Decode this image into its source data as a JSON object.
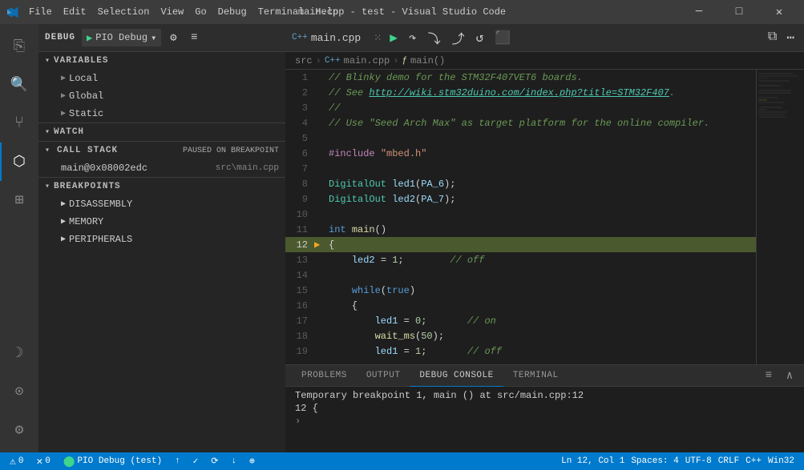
{
  "titleBar": {
    "title": "main.cpp - test - Visual Studio Code",
    "menus": [
      "File",
      "Edit",
      "Selection",
      "View",
      "Go",
      "Debug",
      "Terminal",
      "Help"
    ],
    "controls": [
      "─",
      "□",
      "✕"
    ]
  },
  "activityBar": {
    "items": [
      {
        "name": "explorer",
        "icon": "⎘",
        "label": "Explorer"
      },
      {
        "name": "search",
        "icon": "🔍",
        "label": "Search"
      },
      {
        "name": "source-control",
        "icon": "⑂",
        "label": "Source Control"
      },
      {
        "name": "debug",
        "icon": "▶",
        "label": "Run and Debug",
        "active": true
      },
      {
        "name": "extensions",
        "icon": "⊞",
        "label": "Extensions"
      }
    ],
    "bottomItems": [
      {
        "name": "settings-bot",
        "icon": "☽",
        "label": "PlatformIO"
      },
      {
        "name": "accounts",
        "icon": "⊙",
        "label": "Accounts"
      },
      {
        "name": "settings",
        "icon": "⚙",
        "label": "Settings"
      }
    ]
  },
  "debugPanel": {
    "label": "DEBUG",
    "dropdown": "PIO Debug",
    "toolbar": [
      "▶",
      "⚙",
      "≡"
    ]
  },
  "variables": {
    "header": "VARIABLES",
    "items": [
      {
        "label": "Local",
        "indent": 1,
        "expanded": false
      },
      {
        "label": "Global",
        "indent": 1,
        "expanded": false
      },
      {
        "label": "Static",
        "indent": 1,
        "expanded": false
      }
    ]
  },
  "watch": {
    "header": "WATCH"
  },
  "callStack": {
    "header": "CALL STACK",
    "badge": "PAUSED ON BREAKPOINT",
    "items": [
      {
        "name": "main@0x08002edc",
        "file": "src\\main.cpp"
      }
    ]
  },
  "breakpoints": {
    "header": "BREAKPOINTS",
    "subitems": [
      {
        "label": "DISASSEMBLY"
      },
      {
        "label": "MEMORY"
      },
      {
        "label": "PERIPHERALS"
      }
    ]
  },
  "editorToolbar": {
    "file": "main.cpp",
    "fileIcon": "C++",
    "icons": [
      {
        "name": "split-view",
        "symbol": "⊡"
      },
      {
        "name": "continue",
        "symbol": "▶"
      },
      {
        "name": "step-over",
        "symbol": "↷"
      },
      {
        "name": "step-into",
        "symbol": "⤵"
      },
      {
        "name": "step-out",
        "symbol": "⤴"
      },
      {
        "name": "restart",
        "symbol": "↺"
      },
      {
        "name": "stop",
        "symbol": "⬛",
        "stop": true
      }
    ]
  },
  "breadcrumb": {
    "parts": [
      "src",
      "main.cpp",
      "main()"
    ]
  },
  "code": {
    "lines": [
      {
        "num": 1,
        "content": "// Blinky demo for the STM32F407VET6 boards."
      },
      {
        "num": 2,
        "content": "// See http://wiki.stm32duino.com/index.php?title=STM32F407."
      },
      {
        "num": 3,
        "content": "//"
      },
      {
        "num": 4,
        "content": "// Use \"Seed Arch Max\" as target platform for the online compiler."
      },
      {
        "num": 5,
        "content": ""
      },
      {
        "num": 6,
        "content": "#include \"mbed.h\""
      },
      {
        "num": 7,
        "content": ""
      },
      {
        "num": 8,
        "content": "DigitalOut led1(PA_6);"
      },
      {
        "num": 9,
        "content": "DigitalOut led2(PA_7);"
      },
      {
        "num": 10,
        "content": ""
      },
      {
        "num": 11,
        "content": "int main()"
      },
      {
        "num": 12,
        "content": "{",
        "current": true,
        "arrow": true
      },
      {
        "num": 13,
        "content": "    led2 = 1;        // off"
      },
      {
        "num": 14,
        "content": ""
      },
      {
        "num": 15,
        "content": "    while(true)"
      },
      {
        "num": 16,
        "content": "    {"
      },
      {
        "num": 17,
        "content": "        led1 = 0;       // on"
      },
      {
        "num": 18,
        "content": "        wait_ms(50);"
      },
      {
        "num": 19,
        "content": "        led1 = 1;       // off"
      }
    ]
  },
  "panel": {
    "tabs": [
      "PROBLEMS",
      "OUTPUT",
      "DEBUG CONSOLE",
      "TERMINAL"
    ],
    "activeTab": "DEBUG CONSOLE",
    "content": [
      "Temporary breakpoint 1, main () at src/main.cpp:12",
      "12          {"
    ]
  },
  "statusBar": {
    "left": [
      {
        "icon": "⚠",
        "text": "0"
      },
      {
        "icon": "✕",
        "text": "0"
      },
      {
        "text": "⬤ PIO Debug (test)"
      },
      {
        "text": "↑"
      },
      {
        "text": "✓"
      },
      {
        "text": "⟳"
      },
      {
        "text": "↓"
      },
      {
        "text": "⊕"
      }
    ],
    "right": [
      {
        "text": "Ln 12, Col 1"
      },
      {
        "text": "Spaces: 4"
      },
      {
        "text": "UTF-8"
      },
      {
        "text": "CRLF"
      },
      {
        "text": "C++"
      },
      {
        "text": "Win32"
      }
    ]
  }
}
